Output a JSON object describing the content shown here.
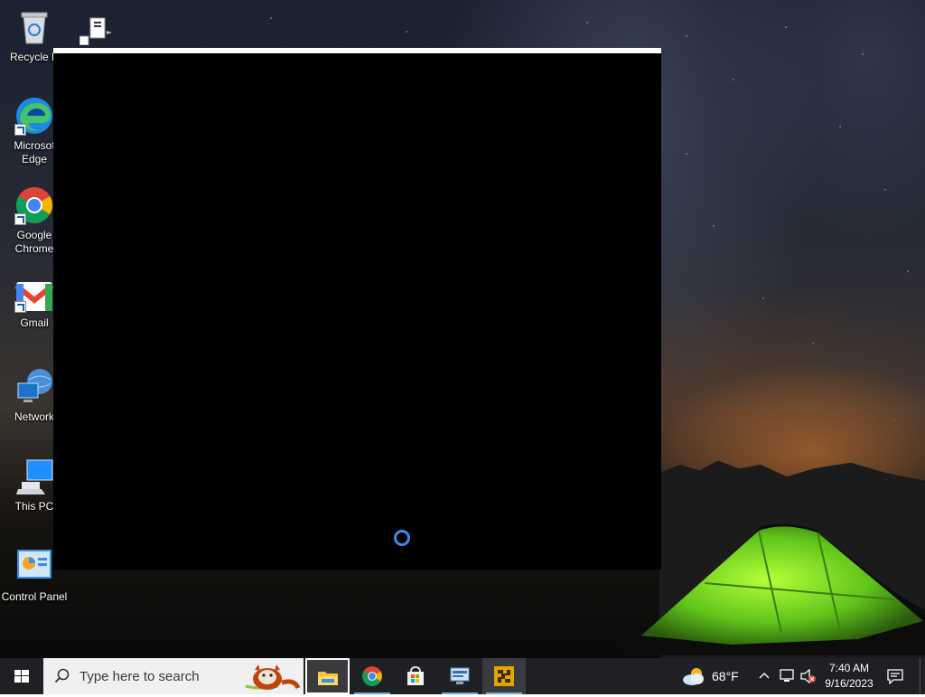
{
  "desktop": {
    "icons": [
      {
        "label": "Recycle Bin",
        "icon": "recycle-bin-icon"
      },
      {
        "label": "Microsoft Edge",
        "icon": "edge-icon"
      },
      {
        "label": "Google Chrome",
        "icon": "chrome-icon"
      },
      {
        "label": "Gmail",
        "icon": "gmail-icon"
      },
      {
        "label": "Network",
        "icon": "network-icon"
      },
      {
        "label": "This PC",
        "icon": "this-pc-icon"
      },
      {
        "label": "Control Panel",
        "icon": "control-panel-icon"
      }
    ],
    "icon_labels": {
      "recycle_l1": "Recycle B",
      "edge_l1": "Microsof",
      "edge_l2": "Edge",
      "chrome_l1": "Google",
      "chrome_l2": "Chrome",
      "gmail": "Gmail",
      "network": "Network",
      "thispc": "This PC",
      "controlpanel": "Control Panel"
    }
  },
  "app_window": {
    "state": "loading",
    "spinner_color": "#3a8ee6"
  },
  "taskbar": {
    "search_placeholder": "Type here to search",
    "pinned_apps": [
      "File Explorer",
      "Google Chrome",
      "Microsoft Store",
      "Remote Desktop",
      "Installer"
    ],
    "weather": {
      "temperature": "68°F",
      "icon": "partly-cloudy-icon"
    },
    "clock": {
      "time": "7:40 AM",
      "date": "9/16/2023"
    },
    "tray_icons": [
      "chevron-up-icon",
      "network-icon",
      "volume-muted-icon",
      "notification-icon"
    ]
  },
  "colors": {
    "taskbar_bg": "#1f2023",
    "window_bg": "#000000",
    "accent": "#3a8ee6",
    "tent_green": "#7ed321"
  }
}
